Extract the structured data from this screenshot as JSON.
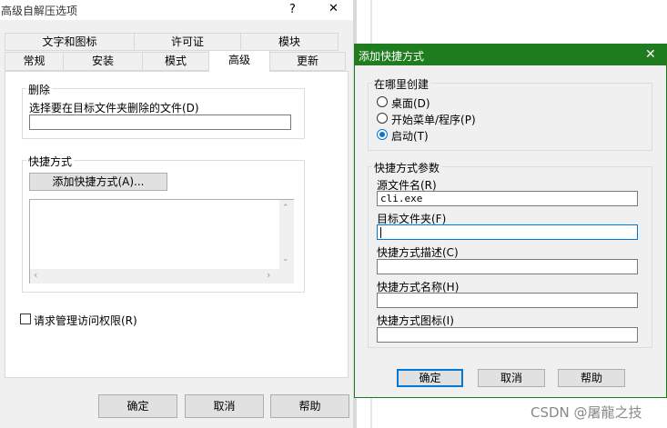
{
  "dialog1": {
    "title": "高级自解压选项",
    "title_buttons": {
      "help": "?",
      "close": "✕"
    },
    "tabs_row1": [
      "文字和图标",
      "许可证",
      "模块"
    ],
    "tabs_row2": [
      "常规",
      "安装",
      "模式",
      "高级",
      "更新"
    ],
    "delete_group": {
      "title": "删除",
      "label": "选择要在目标文件夹删除的文件(D)",
      "value": ""
    },
    "shortcut_group": {
      "title": "快捷方式",
      "add_button": "添加快捷方式(A)..."
    },
    "admin_checkbox": {
      "label": "请求管理访问权限(R)",
      "checked": false
    },
    "buttons": {
      "ok": "确定",
      "cancel": "取消",
      "help": "帮助"
    }
  },
  "dialog2": {
    "title": "添加快捷方式",
    "close": "✕",
    "where_group": {
      "title": "在哪里创建",
      "options": [
        {
          "label": "桌面(D)",
          "selected": false
        },
        {
          "label": "开始菜单/程序(P)",
          "selected": false
        },
        {
          "label": "启动(T)",
          "selected": true
        }
      ]
    },
    "params_group": {
      "title": "快捷方式参数",
      "fields": [
        {
          "label": "源文件名(R)",
          "value": "cli.exe"
        },
        {
          "label": "目标文件夹(F)",
          "value": ""
        },
        {
          "label": "快捷方式描述(C)",
          "value": ""
        },
        {
          "label": "快捷方式名称(H)",
          "value": ""
        },
        {
          "label": "快捷方式图标(I)",
          "value": ""
        }
      ]
    },
    "buttons": {
      "ok": "确定",
      "cancel": "取消",
      "help": "帮助"
    }
  },
  "watermark": "CSDN @屠龍之技",
  "colors": {
    "title_green": "#1f7d1f",
    "focus_blue": "#0078d7"
  }
}
